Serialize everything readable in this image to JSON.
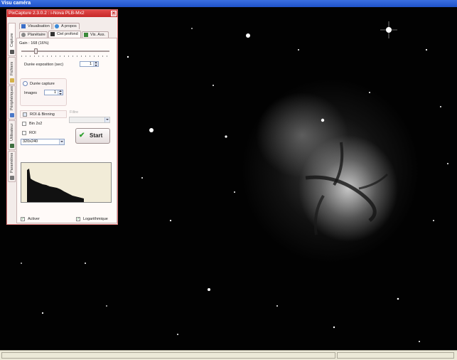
{
  "camera_window": {
    "title": "Visu caméra"
  },
  "pixcapture": {
    "title": "PixCapture 2.3.0.2 : i-Nova PLB-Mx2",
    "close_glyph": "✕",
    "side_tabs": [
      "Capture",
      "Fichiers",
      "Périphériques",
      "Utilisateur",
      "Paramètres"
    ],
    "top_tabs_row1": [
      "Visualisation",
      "A propos"
    ],
    "top_tabs_row2": [
      "Planétaire",
      "Ciel profond",
      "Vis. Ass."
    ],
    "gain_label": "Gain : 168 (16%)",
    "gain_level": 0.16,
    "exposure_label": "Durée exposition (sec)",
    "exposure_value": "1",
    "duration_capture_label": "Durée capture",
    "images_label": "Images",
    "images_value": "1",
    "roi_binning_label": "ROI & Binning",
    "bin_label": "Bin 2x2",
    "roi_label": "ROI",
    "resolution_value": "320x240",
    "filter_label": "Filtre",
    "filter_value": "",
    "start_label": "Start",
    "start_glyph": "✔",
    "activate_label": "Activer",
    "log_label": "Logarithmique",
    "check_glyph": "✓"
  },
  "colors": {
    "titlebar": "#c62828",
    "start_check": "#2fa02f"
  }
}
